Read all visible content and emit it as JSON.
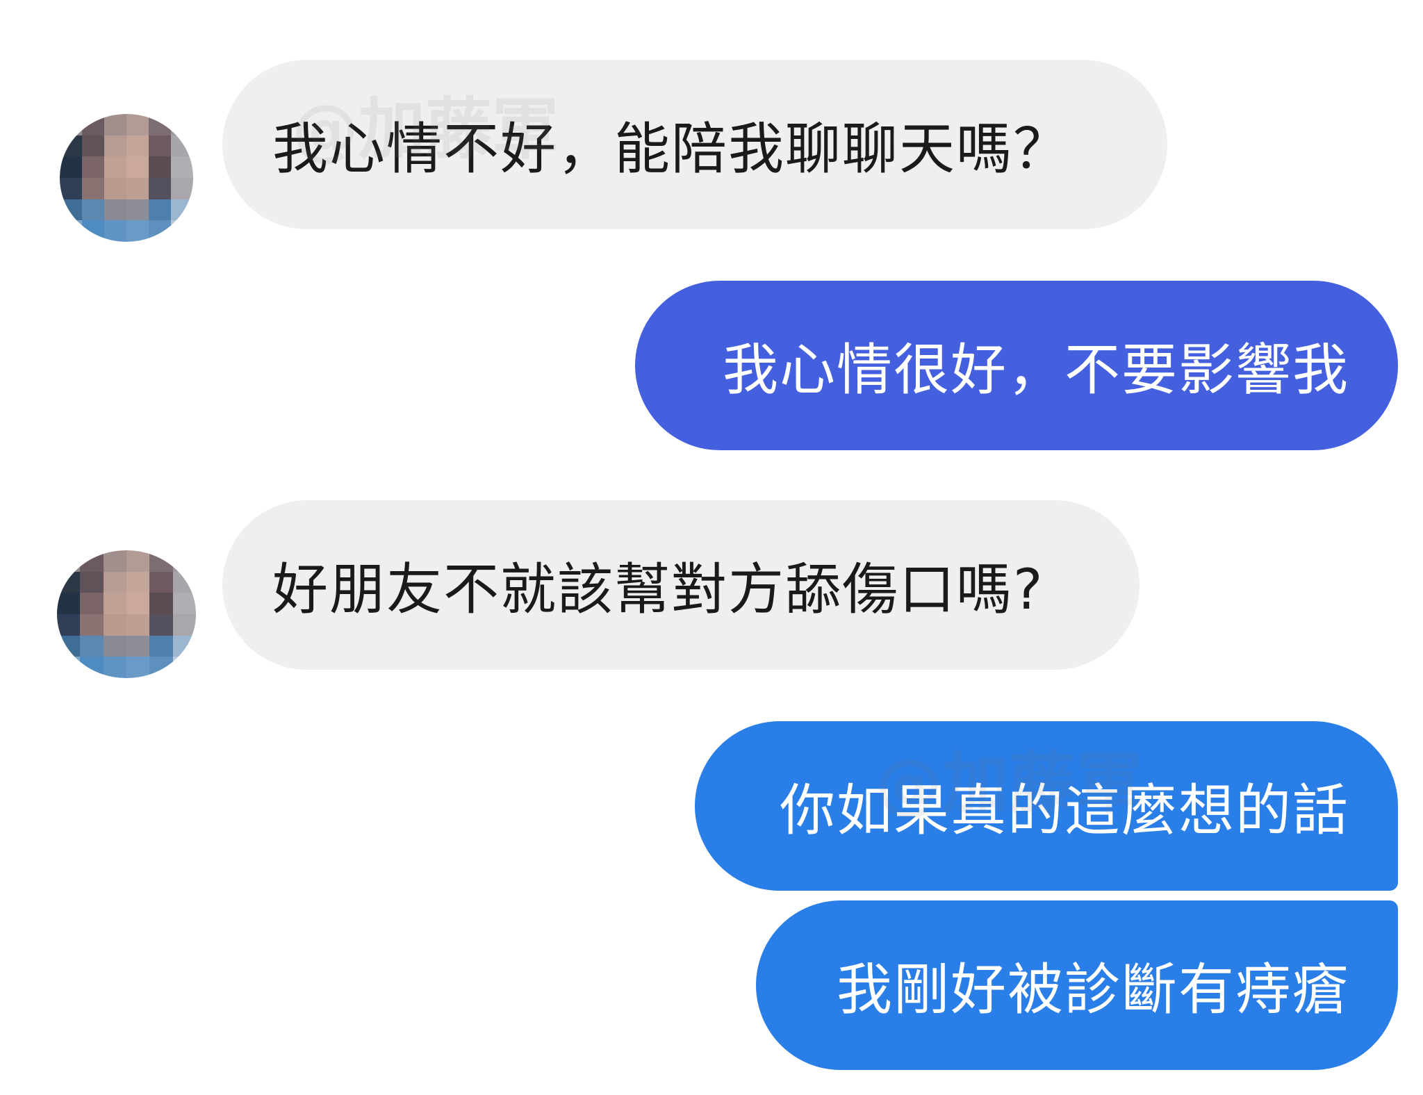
{
  "colors": {
    "incoming_bubble": "#efefef",
    "outgoing_bubble_violet": "#4460df",
    "outgoing_bubble_blue": "#2a7ee8"
  },
  "watermark": {
    "text": "@加藤軍"
  },
  "messages": [
    {
      "sender": "other",
      "text": "我心情不好，能陪我聊聊天嗎？"
    },
    {
      "sender": "me",
      "text": "我心情很好，不要影響我"
    },
    {
      "sender": "other",
      "text": "好朋友不就該幫對方舔傷口嗎?"
    },
    {
      "sender": "me",
      "text": "你如果真的這麼想的話"
    },
    {
      "sender": "me",
      "text": "我剛好被診斷有痔瘡"
    }
  ]
}
